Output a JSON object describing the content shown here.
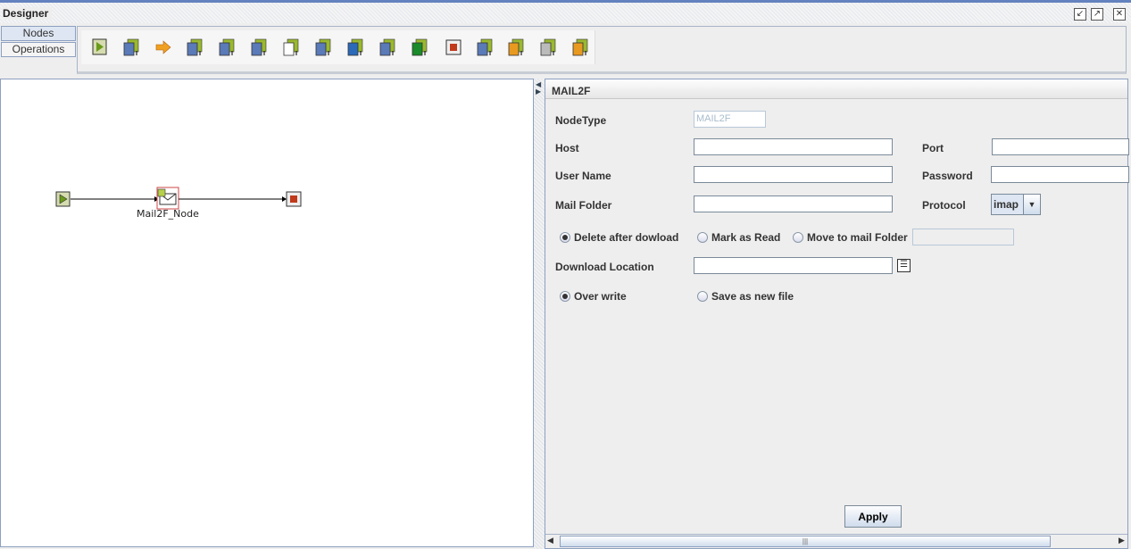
{
  "window": {
    "title": "Designer"
  },
  "tabs": [
    {
      "label": "Nodes"
    },
    {
      "label": "Operations"
    }
  ],
  "toolbar": {
    "icons": [
      "start-node-icon",
      "database-node-icon",
      "arrow-node-icon",
      "database-export-icon",
      "file-database-icon",
      "file-transfer-icon",
      "mail2f-node-icon",
      "file-mail-icon",
      "web-service-icon",
      "file-database-import-icon",
      "excel-icon",
      "stop-node-icon",
      "search-report-icon",
      "xml-db-icon",
      "converter-icon",
      "xml-export-icon"
    ]
  },
  "canvas": {
    "node_label": "Mail2F_Node"
  },
  "panel": {
    "title": "MAIL2F",
    "nodetype_label": "NodeType",
    "nodetype_value": "MAIL2F",
    "host_label": "Host",
    "port_label": "Port",
    "username_label": "User Name",
    "password_label": "Password",
    "mailfolder_label": "Mail Folder",
    "protocol_label": "Protocol",
    "protocol_value": "imap",
    "radio_delete": "Delete after dowload",
    "radio_mark": "Mark as Read",
    "radio_move": "Move to mail Folder",
    "download_label": "Download Location",
    "radio_overwrite": "Over write",
    "radio_savenew": "Save as new file",
    "apply": "Apply"
  }
}
